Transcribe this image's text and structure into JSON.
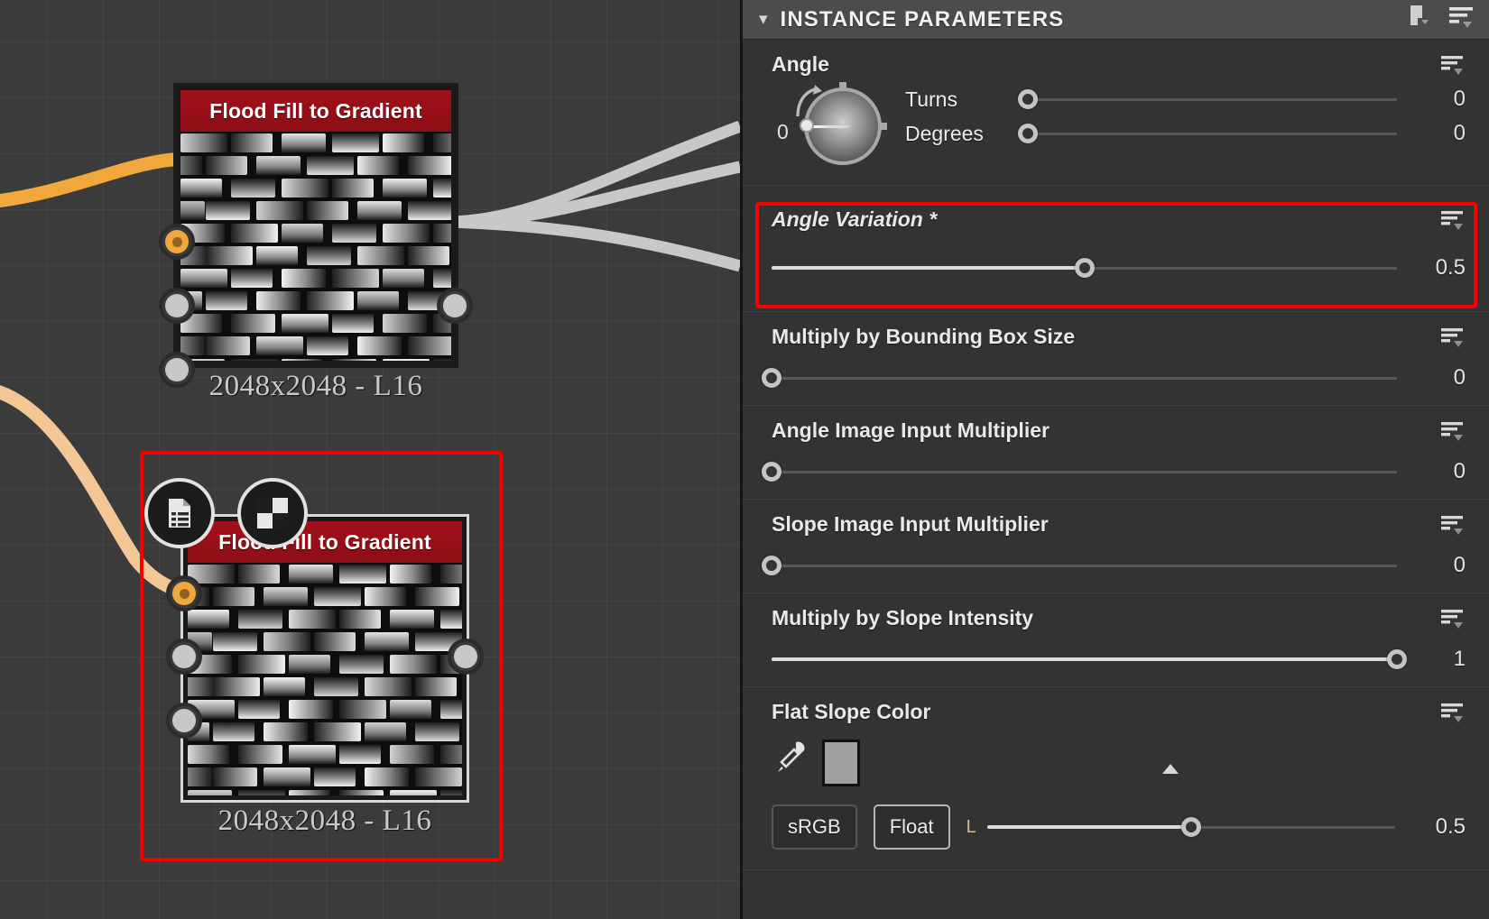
{
  "graph": {
    "nodes": [
      {
        "title": "Flood Fill to Gradient",
        "label": "2048x2048 - L16",
        "selected": false,
        "badges": []
      },
      {
        "title": "Flood Fill to Gradient",
        "label": "2048x2048 - L16",
        "selected": true,
        "badges": [
          "document-list-icon",
          "checkerboard-icon"
        ]
      }
    ],
    "wire_colors": {
      "input": "#f0a73b",
      "input_secondary": "#f0c08a",
      "output": "#c8c8c8"
    },
    "port_colors": {
      "connected": "#f0a73b",
      "idle": "#c8c8c8"
    }
  },
  "panel": {
    "title": "INSTANCE PARAMETERS",
    "collapse_icon": "chevron-down-icon",
    "header_icons": [
      "bookmark-preset-icon",
      "options-menu-icon"
    ],
    "row_menu_icon": "row-options-menu-icon"
  },
  "parameters": [
    {
      "name": "Angle",
      "type": "angle-dial",
      "dial_value": "0",
      "subs": [
        {
          "name": "Turns",
          "value": "0",
          "percent": 0
        },
        {
          "name": "Degrees",
          "value": "0",
          "percent": 0
        }
      ]
    },
    {
      "name": "Angle Variation *",
      "type": "slider",
      "italic": true,
      "highlighted": true,
      "value": "0.5",
      "percent": 50
    },
    {
      "name": "Multiply by Bounding Box Size",
      "type": "slider",
      "value": "0",
      "percent": 0
    },
    {
      "name": "Angle Image Input Multiplier",
      "type": "slider",
      "value": "0",
      "percent": 0
    },
    {
      "name": "Slope Image Input Multiplier",
      "type": "slider",
      "value": "0",
      "percent": 0
    },
    {
      "name": "Multiply by Slope Intensity",
      "type": "slider",
      "value": "1",
      "percent": 100
    },
    {
      "name": "Flat Slope Color",
      "type": "color",
      "eyedropper_icon": "eyedropper-icon",
      "swatch_color": "#a0a0a0",
      "gradient_marker_percent": 50,
      "colorspace_button": "sRGB",
      "format_button": "Float",
      "channel_label": "L",
      "value": "0.5",
      "percent": 50
    }
  ]
}
